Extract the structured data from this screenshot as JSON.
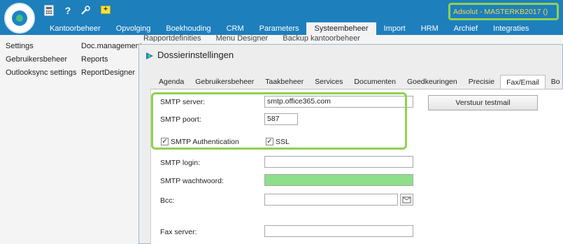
{
  "app": {
    "environment_label": "Adsolut - MASTERKB2017 ()",
    "colors": {
      "brand_blue": "#1e7fbd",
      "highlight_green": "#8fd14f",
      "env_text": "#f5dc3c",
      "password_field": "#8ddf8a"
    }
  },
  "toolbar": {
    "icons": [
      "calculator-icon",
      "help-icon",
      "tools-icon",
      "add-icon"
    ]
  },
  "menu": {
    "items": [
      {
        "label": "Kantoorbeheer"
      },
      {
        "label": "Opvolging"
      },
      {
        "label": "Boekhouding"
      },
      {
        "label": "CRM"
      },
      {
        "label": "Parameters"
      },
      {
        "label": "Systeembeheer",
        "active": true
      },
      {
        "label": "Import"
      },
      {
        "label": "HRM"
      },
      {
        "label": "Archief"
      },
      {
        "label": "Integraties"
      }
    ]
  },
  "ribbon": {
    "col1": [
      "Settings",
      "Gebruikersbeheer",
      "Outlooksync settings"
    ],
    "col2": [
      "Doc.management",
      "Reports",
      "ReportDesigner"
    ],
    "obscured": [
      "Rapportdefinities",
      "Menu Designer",
      "Backup kantoorbeheer"
    ]
  },
  "dialog": {
    "title": "Dossierinstellingen",
    "tabs": [
      {
        "label": "Agenda"
      },
      {
        "label": "Gebruikersbeheer"
      },
      {
        "label": "Taakbeheer"
      },
      {
        "label": "Services"
      },
      {
        "label": "Documenten"
      },
      {
        "label": "Goedkeuringen"
      },
      {
        "label": "Precisie"
      },
      {
        "label": "Fax/Email",
        "active": true
      },
      {
        "label": "Bo"
      }
    ],
    "fields": {
      "smtp_server_label": "SMTP server:",
      "smtp_server_value": "smtp.office365.com",
      "smtp_port_label": "SMTP poort:",
      "smtp_port_value": "587",
      "smtp_auth_label": "SMTP Authentication",
      "smtp_auth_checked": true,
      "ssl_label": "SSL",
      "ssl_checked": true,
      "smtp_login_label": "SMTP login:",
      "smtp_login_value": "",
      "smtp_password_label": "SMTP wachtwoord:",
      "smtp_password_value": "",
      "bcc_label": "Bcc:",
      "bcc_value": "",
      "fax_server_label": "Fax server:",
      "fax_server_value": ""
    },
    "send_test_mail_label": "Verstuur testmail"
  }
}
